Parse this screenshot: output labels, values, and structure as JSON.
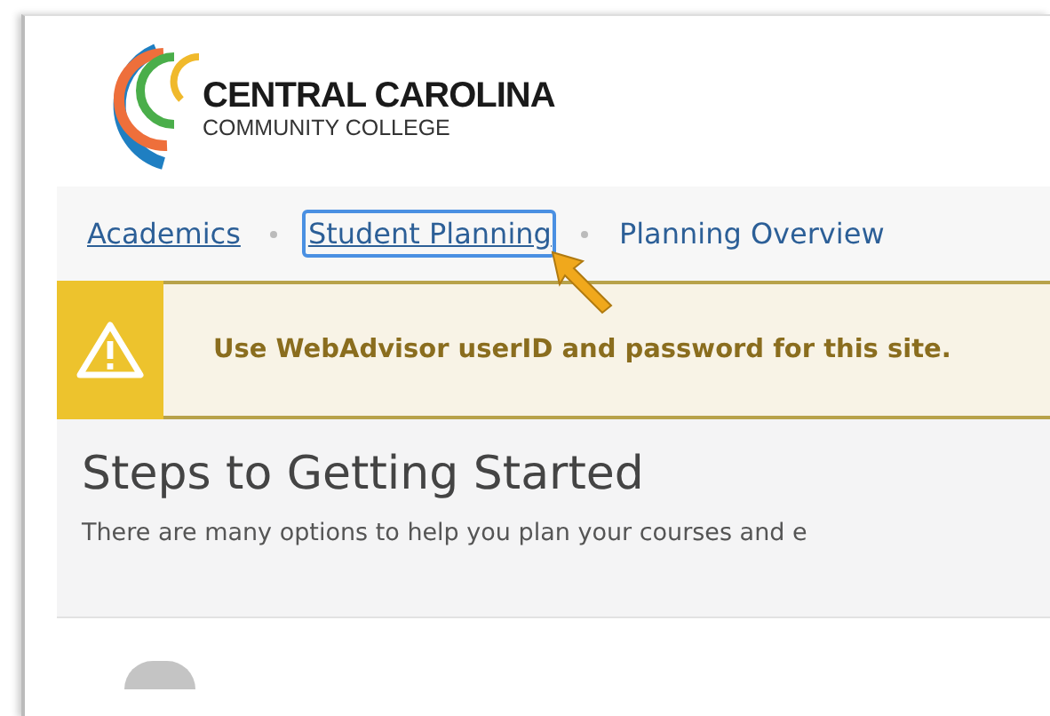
{
  "logo": {
    "name": "CENTRAL CAROLINA",
    "subtitle": "COMMUNITY COLLEGE"
  },
  "breadcrumbs": [
    {
      "label": "Academics",
      "link": true,
      "focused": false
    },
    {
      "label": "Student Planning",
      "link": true,
      "focused": true
    },
    {
      "label": "Planning Overview",
      "link": false,
      "focused": false
    }
  ],
  "alert": {
    "message": "Use WebAdvisor userID and password for this site."
  },
  "intro": {
    "title": "Steps to Getting Started",
    "text": "There are many options to help you plan your courses and e"
  }
}
